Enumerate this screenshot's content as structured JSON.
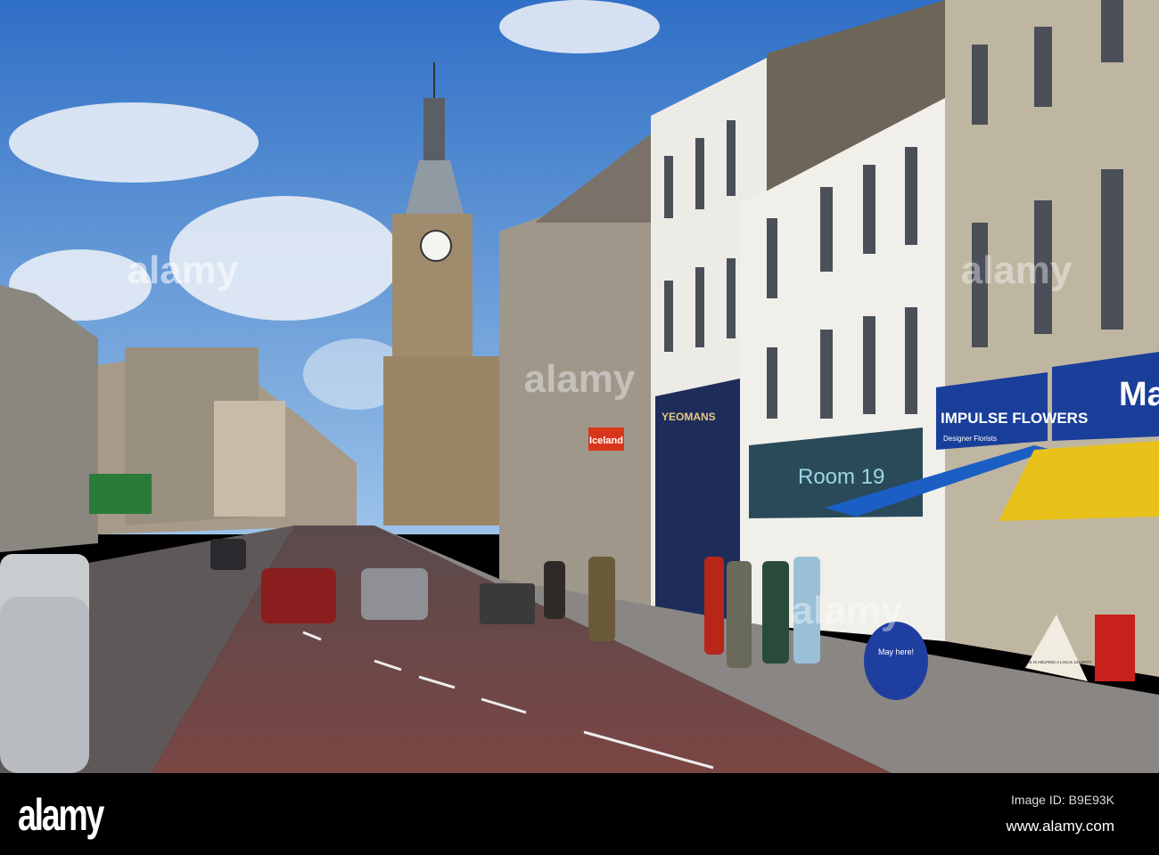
{
  "watermark": {
    "logo": "alamy",
    "image_id": "Image ID: B9E93K",
    "url": "www.alamy.com"
  },
  "shop_signs": {
    "iceland": "Iceland",
    "yeomans": "YEOMANS",
    "impulse_flowers": "IMPULSE FLOWERS",
    "impulse_sub": "Designer Florists",
    "room19": "Room 19",
    "ma": "Ma",
    "lottery_board": "May here!",
    "charity_board": "LOVE IS HELPING A LOCAL CHARITY"
  },
  "colors": {
    "sky": "#3b7fd0",
    "road": "#6b4a48",
    "sign_blue": "#1a3f9a",
    "awning_yellow": "#e8c21a"
  }
}
